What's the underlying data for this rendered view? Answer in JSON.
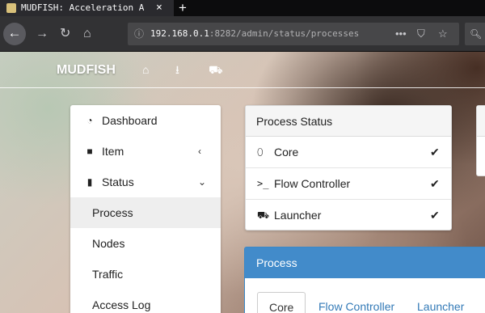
{
  "browser": {
    "tab_title": "MUDFISH: Acceleration A",
    "tab_close": "×",
    "new_tab": "+",
    "url_host": "192.168.0.1",
    "url_rest": ":8282/admin/status/processes",
    "url_more": "•••"
  },
  "header": {
    "brand": "MUDFISH"
  },
  "sidebar": {
    "items": [
      {
        "label": "Dashboard"
      },
      {
        "label": "Item"
      },
      {
        "label": "Status"
      }
    ],
    "subitems": [
      {
        "label": "Process"
      },
      {
        "label": "Nodes"
      },
      {
        "label": "Traffic"
      },
      {
        "label": "Access Log"
      }
    ]
  },
  "process_status": {
    "title": "Process Status",
    "rows": [
      {
        "label": "Core"
      },
      {
        "label": "Flow Controller"
      },
      {
        "label": "Launcher"
      }
    ]
  },
  "process": {
    "title": "Process",
    "tabs": [
      {
        "label": "Core"
      },
      {
        "label": "Flow Controller"
      },
      {
        "label": "Launcher"
      }
    ]
  },
  "colors": {
    "accent": "#428bca",
    "link": "#337ab7",
    "browser_dark": "#323234"
  },
  "icons": [
    "back-arrow-icon",
    "forward-arrow-icon",
    "reload-icon",
    "home-icon",
    "info-icon",
    "more-icon",
    "pocket-icon",
    "star-icon",
    "search-icon",
    "dashboard-icon",
    "gift-icon",
    "bar-chart-icon",
    "download-icon",
    "cart-icon",
    "leaf-icon",
    "terminal-icon",
    "truck-icon",
    "check-icon"
  ]
}
